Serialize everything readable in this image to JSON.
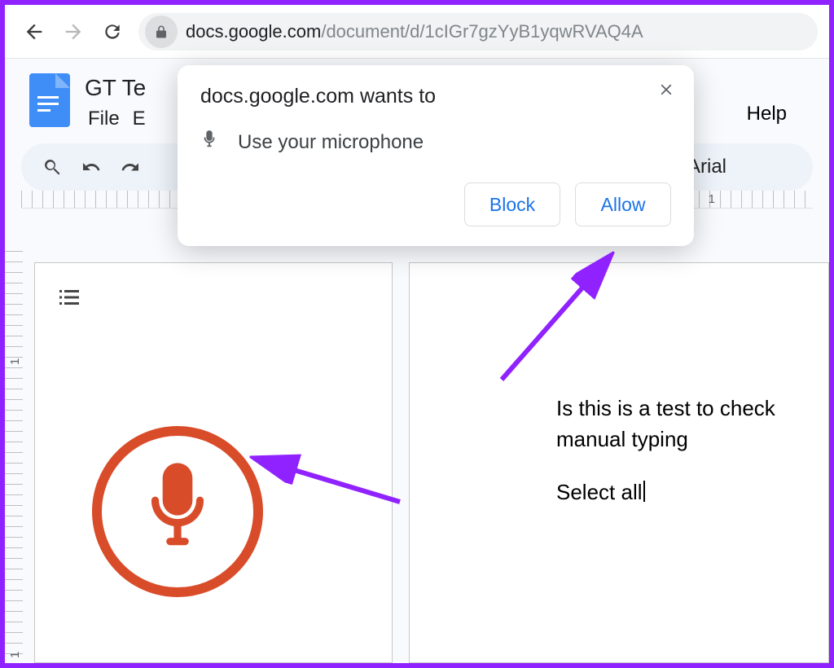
{
  "browser": {
    "url_host": "docs.google.com",
    "url_path": "/document/d/1cIGr7gzYyB1yqwRVAQ4A"
  },
  "docs": {
    "title": "GT Te",
    "menus": [
      "File",
      "E"
    ],
    "help": "Help",
    "font": "Arial",
    "ruler_mark": "1",
    "vruler_marks": [
      "1",
      "1"
    ]
  },
  "document": {
    "line1": "Is this is a test to check",
    "line2": "manual typing",
    "line3": "Select all"
  },
  "dialog": {
    "title": "docs.google.com wants to",
    "message": "Use your microphone",
    "block": "Block",
    "allow": "Allow"
  }
}
